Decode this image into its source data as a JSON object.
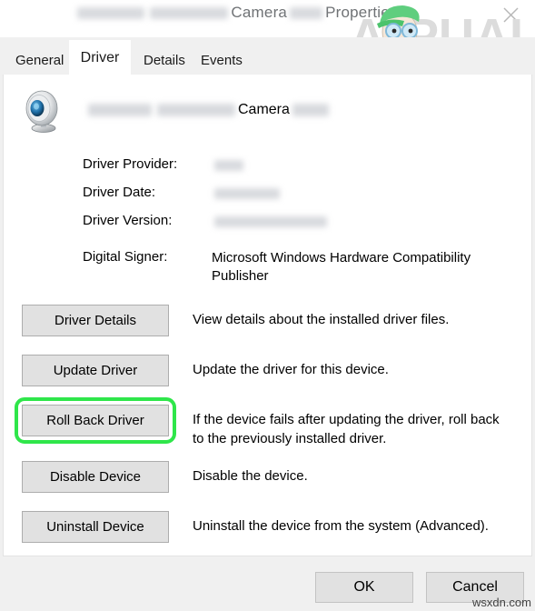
{
  "window": {
    "title_prefix_redacted": true,
    "title_visible_1": "Camera",
    "title_visible_2": "Properties",
    "close_icon": "close-icon"
  },
  "branding": {
    "logo_text": "PUALS",
    "logo_leading_letter": "A",
    "logo_name": "appuals-logo"
  },
  "tabs": [
    {
      "label": "General",
      "selected": false
    },
    {
      "label": "Driver",
      "selected": true
    },
    {
      "label": "Details",
      "selected": false
    },
    {
      "label": "Events",
      "selected": false
    }
  ],
  "device": {
    "icon": "webcam-icon",
    "name_visible": "Camera",
    "name_redacted": true
  },
  "properties": [
    {
      "label": "Driver Provider:",
      "value": "",
      "redacted": true
    },
    {
      "label": "Driver Date:",
      "value": "",
      "redacted": true
    },
    {
      "label": "Driver Version:",
      "value": "",
      "redacted": true
    },
    {
      "label": "Digital Signer:",
      "value": "Microsoft Windows Hardware Compatibility Publisher",
      "redacted": false
    }
  ],
  "actions": [
    {
      "button": "Driver Details",
      "description": "View details about the installed driver files.",
      "highlighted": false
    },
    {
      "button": "Update Driver",
      "description": "Update the driver for this device.",
      "highlighted": false
    },
    {
      "button": "Roll Back Driver",
      "description": "If the device fails after updating the driver, roll back to the previously installed driver.",
      "highlighted": true
    },
    {
      "button": "Disable Device",
      "description": "Disable the device.",
      "highlighted": false
    },
    {
      "button": "Uninstall Device",
      "description": "Uninstall the device from the system (Advanced).",
      "highlighted": false
    }
  ],
  "footer": {
    "ok_label": "OK",
    "cancel_label": "Cancel"
  },
  "watermark": {
    "text": "wsxdn.com"
  },
  "colors": {
    "highlight_green": "#2fe64a",
    "dialog_background": "#f0f0f0",
    "panel_background": "#ffffff",
    "button_face": "#e1e1e1",
    "button_border": "#adadad",
    "title_text": "#6f7275"
  }
}
